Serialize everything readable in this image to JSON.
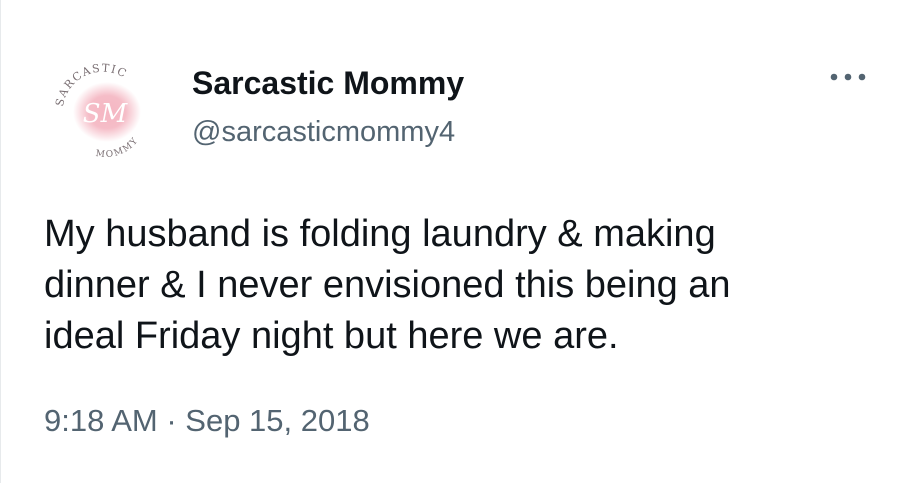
{
  "author": {
    "display_name": "Sarcastic Mommy",
    "handle": "@sarcasticmommy4",
    "avatar": {
      "logo_top_text": "SARCASTIC",
      "logo_bottom_text": "MOMMY",
      "logo_monogram": "SM",
      "accent_color": "#f2a7b5"
    }
  },
  "actions": {
    "more_icon": "more-horizontal-icon"
  },
  "tweet": {
    "text_lines": [
      "My husband is folding laundry & making",
      "dinner & I never envisioned this being an",
      "ideal Friday night but here we are."
    ],
    "timestamp": "9:18 AM · Sep 15, 2018"
  }
}
